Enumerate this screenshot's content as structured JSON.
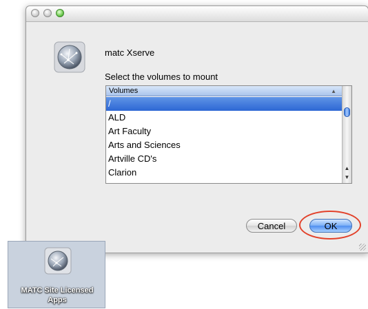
{
  "dialog": {
    "server_name": "matc Xserve",
    "prompt": "Select the volumes to mount",
    "list_header": "Volumes",
    "volumes": [
      "/",
      "ALD",
      "Art Faculty",
      "Arts and Sciences",
      "Artville CD's",
      "Clarion"
    ],
    "selected_volume": "/",
    "cancel_label": "Cancel",
    "ok_label": "OK",
    "icon": "network-globe-icon"
  },
  "desktop": {
    "icon": "network-globe-icon",
    "label_line1": "MATC Site Licensed",
    "label_line2": "Apps"
  },
  "colors": {
    "selection": "#2d67d4",
    "highlight_ring": "#e2412a",
    "window_bg": "#ececec"
  }
}
